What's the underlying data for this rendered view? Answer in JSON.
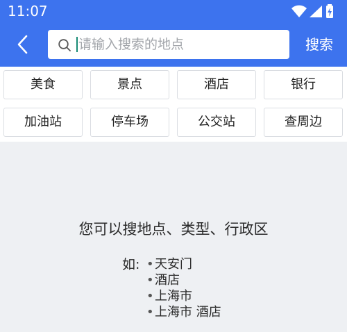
{
  "status_bar": {
    "time": "11:07",
    "icons": [
      "wifi-icon",
      "cellular-signal-icon",
      "battery-charging-icon"
    ]
  },
  "header": {
    "back_icon": "chevron-left-icon",
    "search": {
      "icon": "search-icon",
      "placeholder": "请输入搜索的地点",
      "value": ""
    },
    "search_button_label": "搜索"
  },
  "categories": [
    {
      "label": "美食"
    },
    {
      "label": "景点"
    },
    {
      "label": "酒店"
    },
    {
      "label": "银行"
    },
    {
      "label": "加油站"
    },
    {
      "label": "停车场"
    },
    {
      "label": "公交站"
    },
    {
      "label": "查周边"
    }
  ],
  "hint": {
    "title": "您可以搜地点、类型、行政区",
    "examples_prefix": "如:",
    "examples": [
      "天安门",
      "酒店",
      "上海市",
      "上海市 酒店"
    ]
  },
  "colors": {
    "primary": "#3d73ee",
    "background": "#eef0f3",
    "caret": "#168a74"
  }
}
